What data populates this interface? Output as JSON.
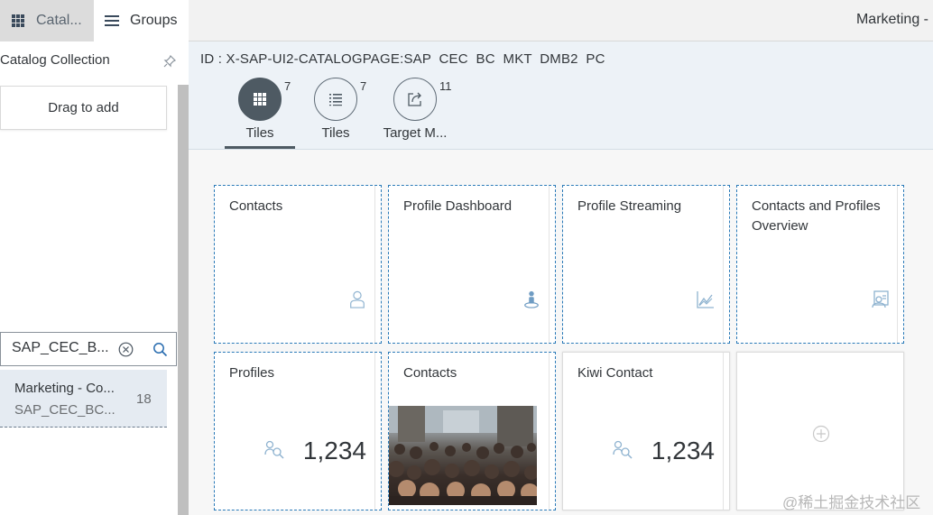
{
  "left": {
    "tab_catalog": "Catal...",
    "tab_groups": "Groups",
    "catalog_collection": "Catalog Collection",
    "drag_to_add": "Drag to add",
    "search_value": "SAP_CEC_B...",
    "catalog_item": {
      "title": "Marketing - Co...",
      "subtitle": "SAP_CEC_BC...",
      "count": "18"
    }
  },
  "topbar": {
    "title": "Marketing -"
  },
  "header": {
    "catalog_id": "ID : X-SAP-UI2-CATALOGPAGE:SAP  CEC  BC  MKT  DMB2  PC",
    "tabs": [
      {
        "label": "Tiles",
        "count": "7",
        "icon": "grid-icon",
        "selected": true
      },
      {
        "label": "Tiles",
        "count": "7",
        "icon": "list-icon",
        "selected": false
      },
      {
        "label": "Target M...",
        "count": "11",
        "icon": "share-icon",
        "selected": false
      }
    ]
  },
  "tiles": [
    {
      "title": "Contacts",
      "icon": "person-icon"
    },
    {
      "title": "Profile Dashboard",
      "icon": "map-pin-person-icon"
    },
    {
      "title": "Profile Streaming",
      "icon": "line-chart-icon"
    },
    {
      "title": "Contacts and Profiles Overview",
      "icon": "contact-card-icon"
    },
    {
      "title": "Profiles",
      "number": "1,234",
      "icon": "people-search-icon"
    },
    {
      "title": "Contacts",
      "icon": "crowd-photo"
    },
    {
      "title": "Kiwi Contact",
      "number": "1,234",
      "icon": "people-search-icon"
    },
    {
      "title": "",
      "icon": "add-icon"
    }
  ],
  "watermark": "@稀土掘金技术社区",
  "colors": {
    "accent_dashed": "#2a7ab8",
    "selected_tab": "#4e5a63",
    "header_bg": "#edf2f7"
  }
}
